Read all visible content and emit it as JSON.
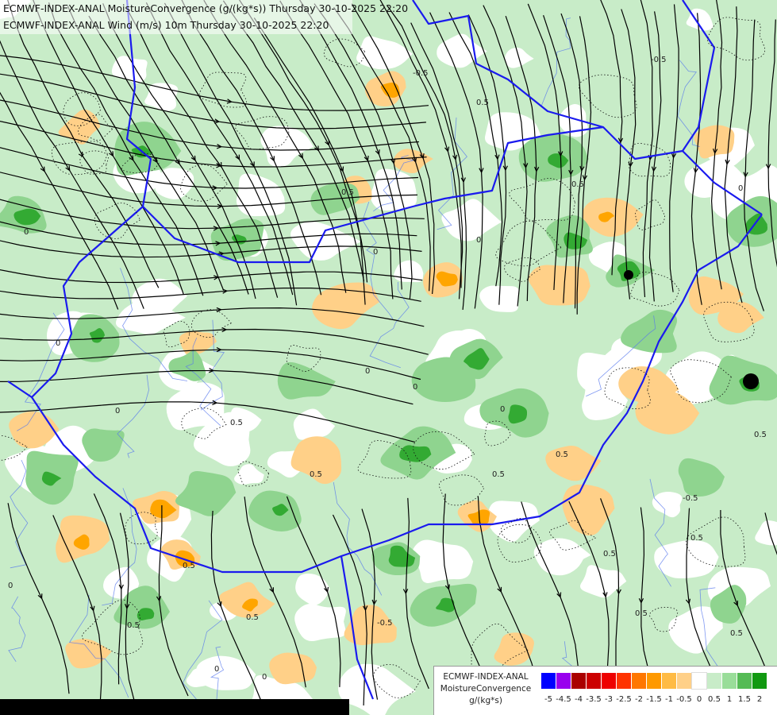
{
  "titles": {
    "line1": "ECMWF-INDEX-ANAL MoistureConvergence (g/(kg*s)) Thursday 30-10-2025 22:20",
    "line2": "ECMWF-INDEX-ANAL Wind (m/s) 10m Thursday 30-10-2025 22:20"
  },
  "legend": {
    "line1": "ECMWF-INDEX-ANAL",
    "line2": "MoistureConvergence",
    "line3": "g/(kg*s)",
    "ticks": [
      "-5",
      "-4.5",
      "-4",
      "-3.5",
      "-3",
      "-2.5",
      "-2",
      "-1.5",
      "-1",
      "-0.5",
      "0",
      "0.5",
      "1",
      "1.5",
      "2"
    ],
    "colors": [
      "#0000ff",
      "#9900ee",
      "#aa0000",
      "#cc0000",
      "#ee0000",
      "#ff3300",
      "#ff7700",
      "#ff9900",
      "#ffbb44",
      "#ffd088",
      "#ffffff",
      "#c8ecc8",
      "#99dd99",
      "#55bb55",
      "#119911"
    ]
  },
  "contour_labels": [
    "0",
    "-0.5",
    "0.5"
  ],
  "colors": {
    "border": "#1a1aee",
    "river": "#5577ee",
    "streamline": "#000000",
    "convergence_light": "#c8ecc8",
    "convergence_mid": "#8fd48f",
    "convergence_strong": "#33aa33",
    "divergence_light": "#ffd088",
    "divergence_strong": "#ffa500"
  }
}
